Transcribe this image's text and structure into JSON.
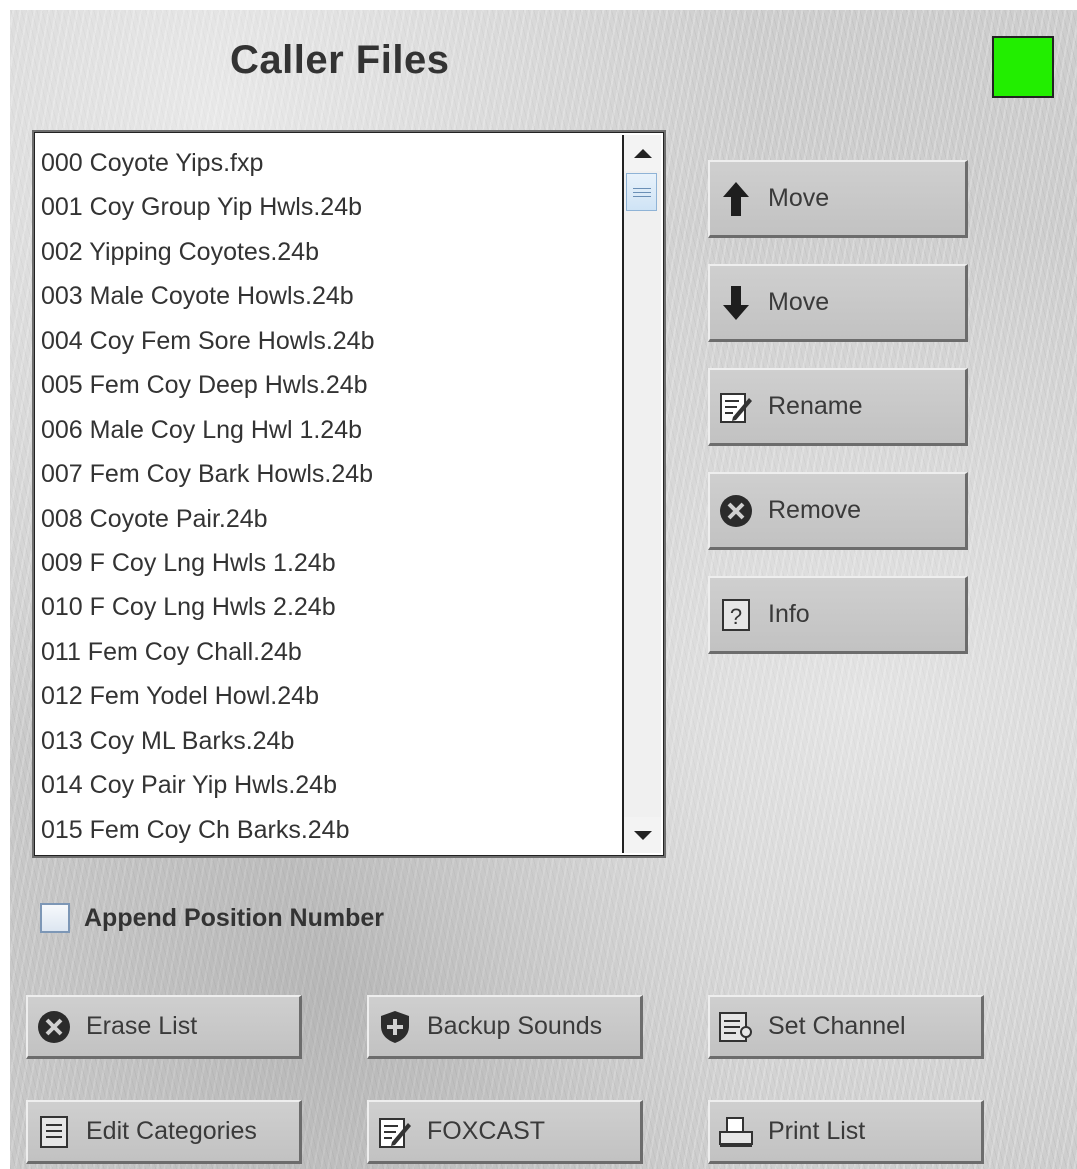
{
  "title": "Caller Files",
  "status_color": "#22ee00",
  "files": [
    "000 Coyote Yips.fxp",
    "001 Coy Group Yip Hwls.24b",
    "002 Yipping Coyotes.24b",
    "003 Male Coyote Howls.24b",
    "004 Coy Fem Sore Howls.24b",
    "005 Fem Coy Deep Hwls.24b",
    "006 Male Coy Lng Hwl 1.24b",
    "007 Fem Coy Bark Howls.24b",
    "008 Coyote Pair.24b",
    "009 F Coy Lng Hwls 1.24b",
    "010 F Coy Lng Hwls 2.24b",
    "011 Fem Coy Chall.24b",
    "012 Fem Yodel Howl.24b",
    "013 Coy ML Barks.24b",
    "014 Coy Pair Yip Hwls.24b",
    "015 Fem Coy Ch Barks.24b"
  ],
  "side_buttons": {
    "move_up": {
      "label": "Move",
      "icon": "arrow-up-icon"
    },
    "move_down": {
      "label": "Move",
      "icon": "arrow-down-icon"
    },
    "rename": {
      "label": "Rename",
      "icon": "edit-icon"
    },
    "remove": {
      "label": "Remove",
      "icon": "remove-icon"
    },
    "info": {
      "label": "Info",
      "icon": "info-icon"
    }
  },
  "append_position": {
    "label": "Append Position Number",
    "checked": false
  },
  "bottom_buttons": {
    "erase_list": {
      "label": "Erase List",
      "icon": "erase-icon"
    },
    "backup_sounds": {
      "label": "Backup Sounds",
      "icon": "shield-icon"
    },
    "set_channel": {
      "label": "Set Channel",
      "icon": "channel-icon"
    },
    "edit_categories": {
      "label": "Edit Categories",
      "icon": "list-icon"
    },
    "foxcast": {
      "label": "FOXCAST",
      "icon": "edit-icon"
    },
    "print_list": {
      "label": "Print List",
      "icon": "printer-icon"
    }
  }
}
